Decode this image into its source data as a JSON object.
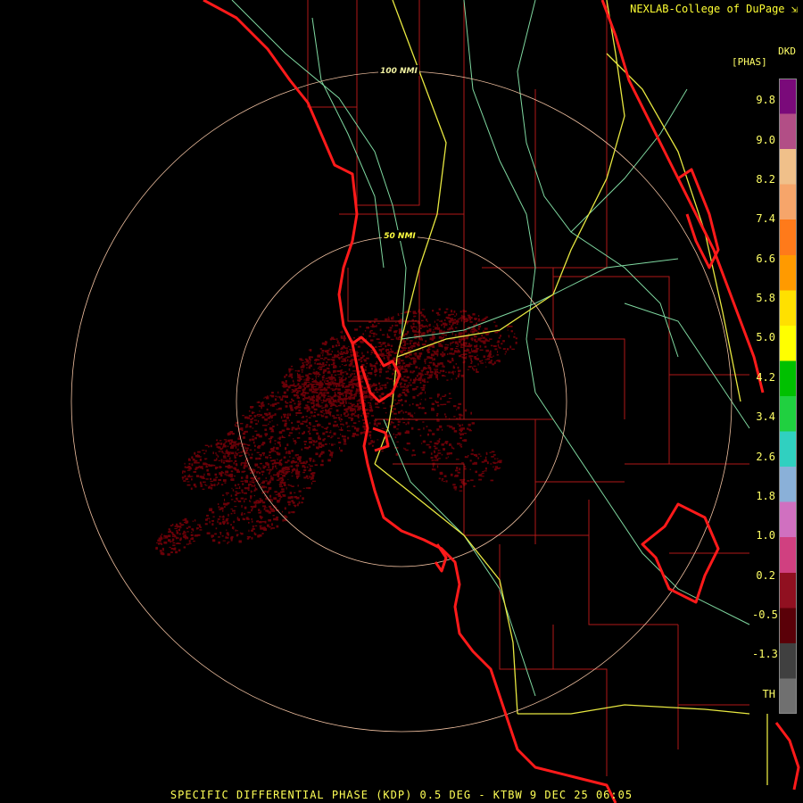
{
  "header": {
    "credit": "NEXLAB-College of DuPage",
    "credit_icon": "nexlab-arrow-icon"
  },
  "legend": {
    "units": "[PHAS]",
    "label": "DKD",
    "ticks": [
      "9.8",
      "9.0",
      "8.2",
      "7.4",
      "6.6",
      "5.8",
      "5.0",
      "4.2",
      "3.4",
      "2.6",
      "1.8",
      "1.0",
      "0.2",
      "-0.5",
      "-1.3",
      "TH"
    ],
    "colors": [
      "#7a0a7a",
      "#b24e86",
      "#f0c08a",
      "#f6a56a",
      "#ff7a1a",
      "#ff9a00",
      "#ffe000",
      "#ffff00",
      "#00c000",
      "#20d040",
      "#30d0c0",
      "#8ab0d8",
      "#d070c0",
      "#d04080",
      "#901020",
      "#5a0008",
      "#404040",
      "#707070"
    ]
  },
  "map": {
    "range_rings": [
      {
        "label": "100 NMI",
        "range_nmi": 100
      },
      {
        "label": "50 NMI",
        "range_nmi": 50
      }
    ],
    "colors": {
      "coast": "#ff1a1a",
      "county": "#c01818",
      "road_major": "#e8e840",
      "road_minor": "#7fd8a0",
      "ring": "#f0c0a0",
      "echo": "#6a0008"
    }
  },
  "footer": {
    "product": "SPECIFIC DIFFERENTIAL PHASE (KDP) 0.5 DEG - KTBW 9 DEC 25 06:05"
  }
}
